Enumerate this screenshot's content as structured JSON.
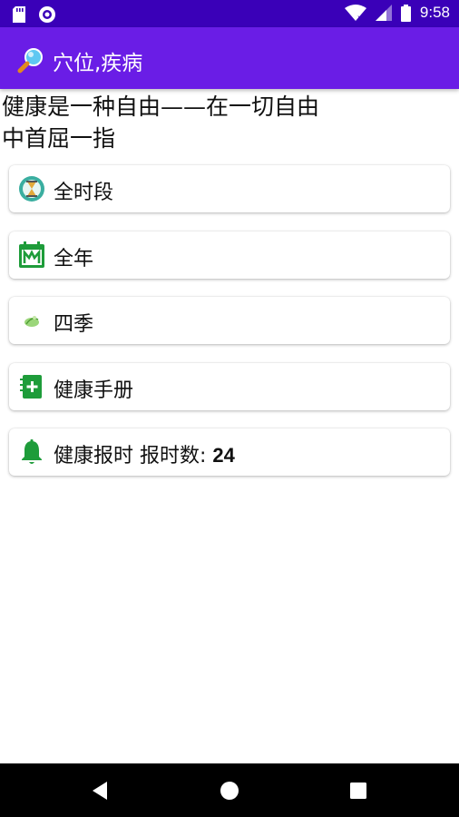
{
  "status_bar": {
    "time": "9:58",
    "icons": [
      "sd-card-icon",
      "circle-notification-icon",
      "wifi-icon",
      "signal-icon",
      "battery-icon"
    ]
  },
  "app_bar": {
    "title": "穴位,疾病",
    "icon": "magnifier-icon",
    "color": "#6a1de6",
    "status_color": "#3a00b8"
  },
  "motto": "健康是一种自由——在一切自由\n中首屈一指",
  "menu": [
    {
      "label": "全时段",
      "icon": "hourglass-clock-icon"
    },
    {
      "label": "全年",
      "icon": "calendar-icon"
    },
    {
      "label": "四季",
      "icon": "season-leaf-icon"
    },
    {
      "label": "健康手册",
      "icon": "health-book-icon"
    },
    {
      "label": "健康报时 报时数: ",
      "count": "24",
      "icon": "bell-icon"
    }
  ],
  "nav_bar": {
    "buttons": [
      "back-button",
      "home-button",
      "recents-button"
    ]
  }
}
